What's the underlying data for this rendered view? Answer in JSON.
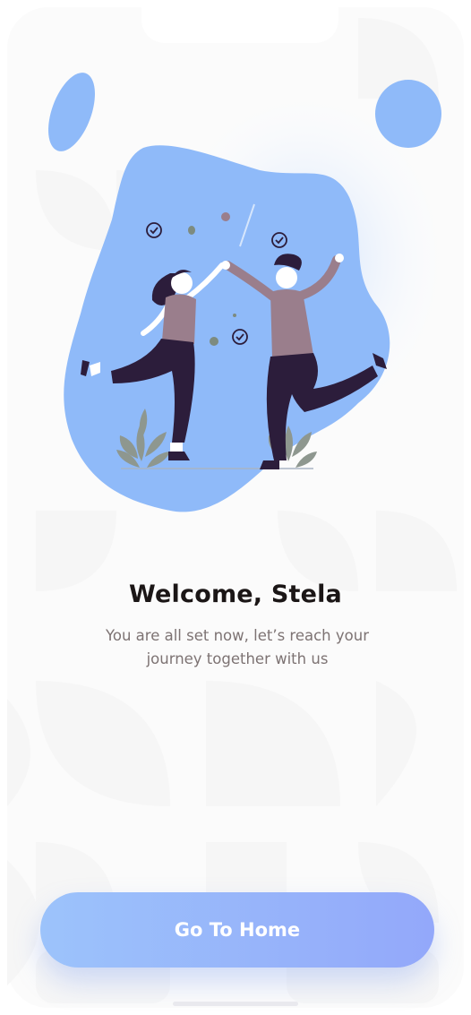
{
  "onboarding": {
    "title": "Welcome, Stela",
    "subtitle": "You are all set now, let’s reach your journey together with us"
  },
  "actions": {
    "home_button_label": "Go To Home"
  },
  "colors": {
    "accent_blue": "#8fbaf9",
    "button_gradient_start": "#9cc3fb",
    "button_gradient_end": "#93a8fa",
    "title": "#1b1616",
    "subtitle": "#7d7373",
    "figure_shirt": "#9a7e8c",
    "figure_pants": "#2c1d3b"
  },
  "icons": [
    "check-circle-icon",
    "leaf-plant-icon"
  ]
}
